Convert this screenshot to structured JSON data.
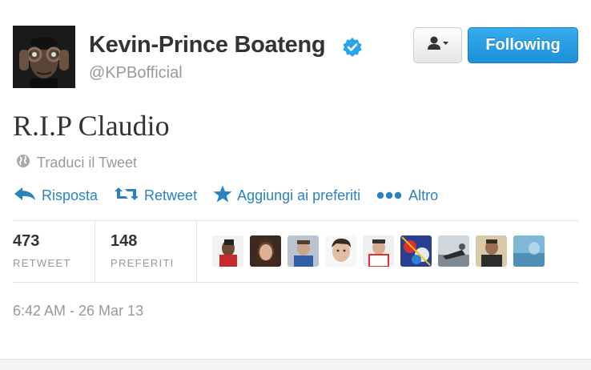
{
  "profile": {
    "name": "Kevin-Prince Boateng",
    "handle": "@KPBofficial",
    "avatar_icon": "profile-photo",
    "verified_icon": "verified-badge-icon",
    "verified_color": "#2aa3ef"
  },
  "buttons": {
    "user_actions_icon": "user-dropdown-icon",
    "follow_label": "Following",
    "follow_color": "#2b9fe6"
  },
  "tweet": {
    "text": "R.I.P Claudio",
    "translate_label": "Traduci il Tweet"
  },
  "actions": [
    {
      "icon": "reply-icon",
      "label": "Risposta"
    },
    {
      "icon": "retweet-icon",
      "label": "Retweet"
    },
    {
      "icon": "star-icon",
      "label": "Aggiungi ai preferiti"
    },
    {
      "icon": "more-dots-icon",
      "label": "Altro"
    }
  ],
  "stats": {
    "retweets": {
      "count": "473",
      "label": "RETWEET"
    },
    "favorites": {
      "count": "148",
      "label": "PREFERITI"
    }
  },
  "favoriters": [
    {
      "name": "favoriter-avatar-1"
    },
    {
      "name": "favoriter-avatar-2"
    },
    {
      "name": "favoriter-avatar-3"
    },
    {
      "name": "favoriter-avatar-4"
    },
    {
      "name": "favoriter-avatar-5"
    },
    {
      "name": "favoriter-avatar-6"
    },
    {
      "name": "favoriter-avatar-7"
    },
    {
      "name": "favoriter-avatar-8"
    },
    {
      "name": "favoriter-avatar-9"
    }
  ],
  "timestamp": "6:42 AM - 26 Mar 13",
  "colors": {
    "link": "#2a83c0",
    "muted": "#999999",
    "text": "#333333"
  }
}
